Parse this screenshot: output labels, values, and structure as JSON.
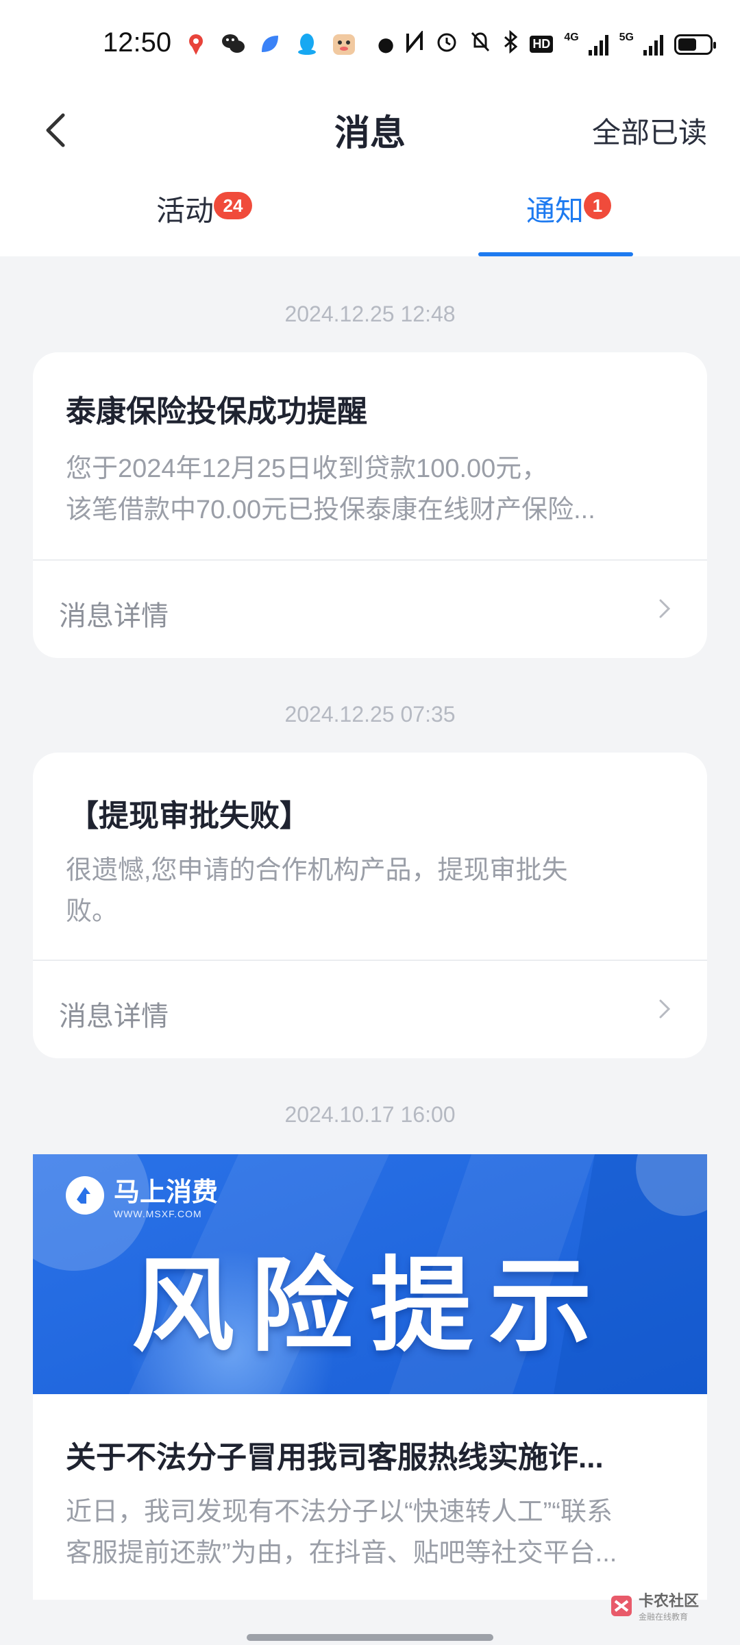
{
  "status_bar": {
    "time": "12:50",
    "hd_label": "HD",
    "net_4g": "4G",
    "net_5g": "5G",
    "battery_level": 0.6
  },
  "header": {
    "title": "消息",
    "mark_all_read": "全部已读"
  },
  "tabs": [
    {
      "label": "活动",
      "badge": "24",
      "active": false
    },
    {
      "label": "通知",
      "badge": "1",
      "active": true
    }
  ],
  "colors": {
    "accent": "#1d7af0",
    "badge": "#f04b3b",
    "background": "#f3f4f6"
  },
  "messages": [
    {
      "date": "2024.12.25 12:48",
      "title": "泰康保险投保成功提醒",
      "body_line1": "您于2024年12月25日收到贷款100.00元，",
      "body_line2": "该笔借款中70.00元已投保泰康在线财产保险...",
      "detail_label": "消息详情"
    },
    {
      "date": "2024.12.25 07:35",
      "title": "【提现审批失败】",
      "body_line1": "很遗憾,您申请的合作机构产品，提现审批失",
      "body_line2": "败。",
      "detail_label": "消息详情"
    },
    {
      "date": "2024.10.17 16:00",
      "banner_brand": "马上消费",
      "banner_url": "WWW.MSXF.COM",
      "banner_text": "风险提示",
      "title": "关于不法分子冒用我司客服热线实施诈...",
      "body_line1": "近日，我司发现有不法分子以“快速转人工”“联系",
      "body_line2": "客服提前还款”为由，在抖音、贴吧等社交平台..."
    }
  ],
  "watermark": {
    "name": "卡农社区",
    "sub": "金融在线教育"
  }
}
